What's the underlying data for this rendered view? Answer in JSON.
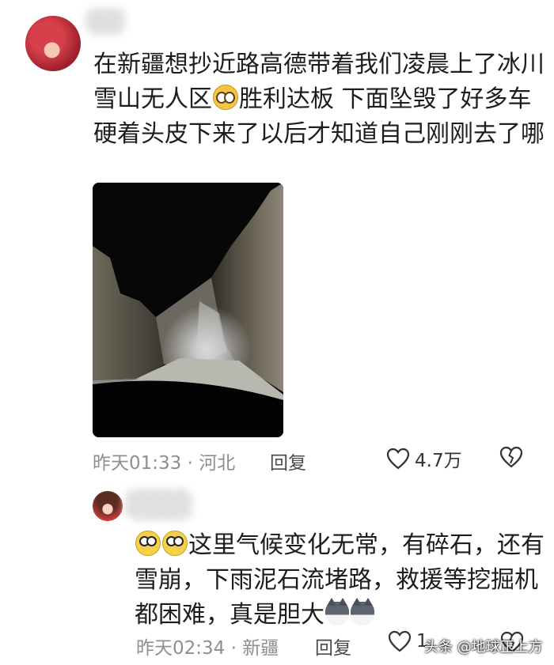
{
  "comments": [
    {
      "text_before_emoji": "在新疆想抄近路高德带着我们凌晨上了冰川雪山无人区",
      "emoji": "pleading-face-emoji",
      "text_after_emoji": "胜利达板 下面坠毁了好多车 硬着头皮下来了以后才知道自己刚刚去了哪",
      "time": "昨天01:33",
      "location": "河北",
      "reply_label": "回复",
      "like_count": "4.7万"
    },
    {
      "leading_emojis": [
        "astonished-face-emoji",
        "astonished-face-emoji"
      ],
      "text": "这里气候变化无常，有碎石，还有雪崩，下雨泥石流堵路，救援等挖掘机都困难，真是胆大",
      "trailing_emojis": [
        "husky-emoji",
        "husky-emoji"
      ],
      "time": "昨天02:34",
      "location": "新疆",
      "reply_label": "回复",
      "like_count": "1"
    }
  ],
  "watermark": "头条 @地球正上方",
  "colors": {
    "meta": "#8f8f8f",
    "text": "#1d1d1d"
  }
}
